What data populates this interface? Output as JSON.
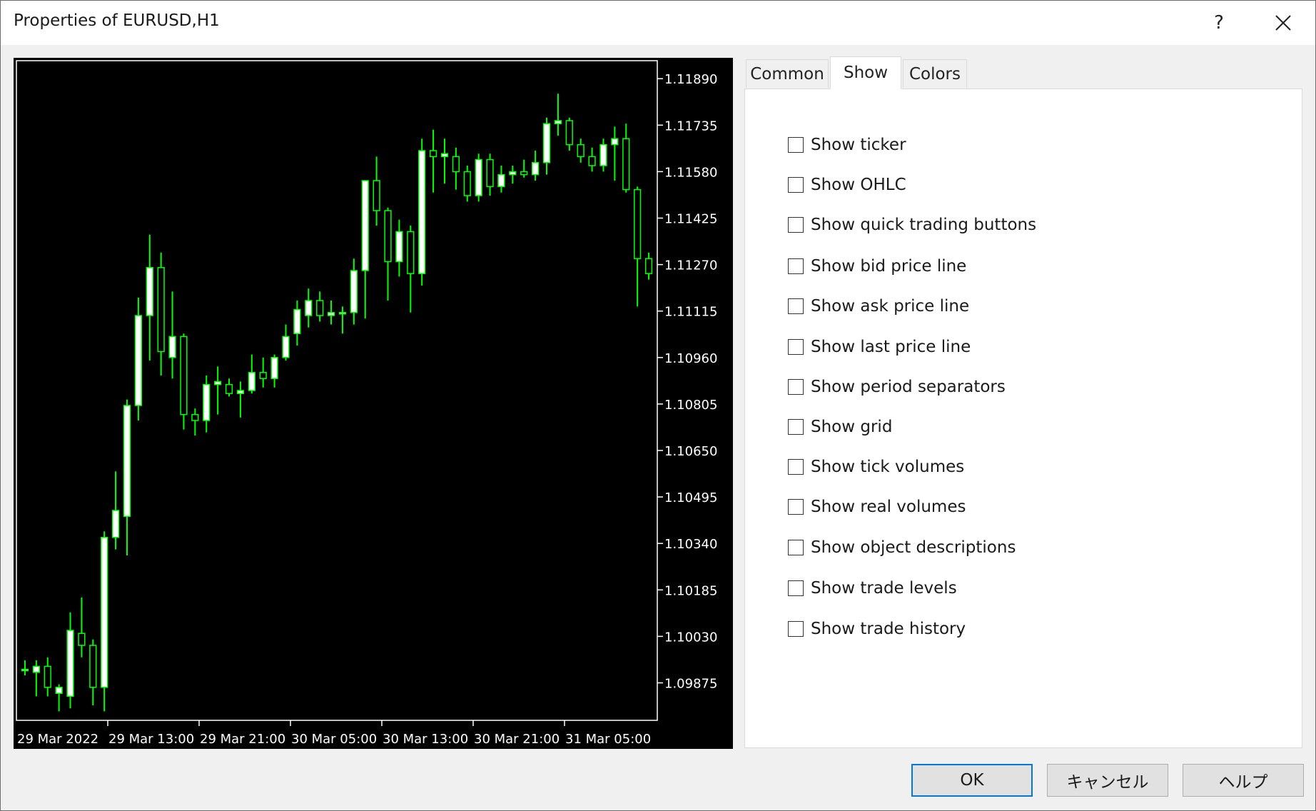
{
  "window": {
    "title": "Properties of EURUSD,H1",
    "help_glyph": "?",
    "close_glyph": "✕"
  },
  "chart": {
    "symbol": "EURUSD",
    "timeframe": "H1",
    "background": "#000000",
    "bull_color": "#ffffff",
    "wick_color": "#00ff00",
    "axis_color": "#ffffff"
  },
  "chart_data": {
    "type": "candlestick",
    "ylim": [
      1.0975,
      1.1195
    ],
    "y_ticks": [
      "1.11890",
      "1.11735",
      "1.11580",
      "1.11425",
      "1.11270",
      "1.11115",
      "1.10960",
      "1.10805",
      "1.10650",
      "1.10495",
      "1.10340",
      "1.10185",
      "1.10030",
      "1.09875"
    ],
    "x_ticks": [
      "29 Mar 2022",
      "29 Mar 13:00",
      "29 Mar 21:00",
      "30 Mar 05:00",
      "30 Mar 13:00",
      "30 Mar 21:00",
      "31 Mar 05:00"
    ],
    "candles": [
      {
        "o": 1.0992,
        "h": 1.0995,
        "l": 1.099,
        "c": 1.0992
      },
      {
        "o": 1.0991,
        "h": 1.0995,
        "l": 1.0983,
        "c": 1.0993
      },
      {
        "o": 1.0993,
        "h": 1.0996,
        "l": 1.0983,
        "c": 1.0986
      },
      {
        "o": 1.0984,
        "h": 1.0987,
        "l": 1.0978,
        "c": 1.0986
      },
      {
        "o": 1.0983,
        "h": 1.1011,
        "l": 1.0979,
        "c": 1.1005
      },
      {
        "o": 1.1004,
        "h": 1.1016,
        "l": 1.0996,
        "c": 1.1
      },
      {
        "o": 1.1,
        "h": 1.1002,
        "l": 1.098,
        "c": 1.0986
      },
      {
        "o": 1.0986,
        "h": 1.1038,
        "l": 1.0978,
        "c": 1.1036
      },
      {
        "o": 1.1036,
        "h": 1.1058,
        "l": 1.1032,
        "c": 1.1045
      },
      {
        "o": 1.1043,
        "h": 1.1082,
        "l": 1.103,
        "c": 1.108
      },
      {
        "o": 1.108,
        "h": 1.1116,
        "l": 1.1075,
        "c": 1.111
      },
      {
        "o": 1.111,
        "h": 1.1137,
        "l": 1.1095,
        "c": 1.1126
      },
      {
        "o": 1.1126,
        "h": 1.1131,
        "l": 1.109,
        "c": 1.1098
      },
      {
        "o": 1.1096,
        "h": 1.1118,
        "l": 1.1089,
        "c": 1.1103
      },
      {
        "o": 1.1103,
        "h": 1.1104,
        "l": 1.1072,
        "c": 1.1077
      },
      {
        "o": 1.1077,
        "h": 1.1079,
        "l": 1.107,
        "c": 1.1075
      },
      {
        "o": 1.1075,
        "h": 1.109,
        "l": 1.1071,
        "c": 1.1087
      },
      {
        "o": 1.1087,
        "h": 1.1093,
        "l": 1.1077,
        "c": 1.1088
      },
      {
        "o": 1.1087,
        "h": 1.1089,
        "l": 1.1083,
        "c": 1.1084
      },
      {
        "o": 1.1084,
        "h": 1.1088,
        "l": 1.1076,
        "c": 1.1085
      },
      {
        "o": 1.1085,
        "h": 1.1097,
        "l": 1.1084,
        "c": 1.1091
      },
      {
        "o": 1.1091,
        "h": 1.1096,
        "l": 1.1086,
        "c": 1.1089
      },
      {
        "o": 1.1089,
        "h": 1.1097,
        "l": 1.1086,
        "c": 1.1096
      },
      {
        "o": 1.1096,
        "h": 1.1107,
        "l": 1.1095,
        "c": 1.1103
      },
      {
        "o": 1.1104,
        "h": 1.1115,
        "l": 1.11,
        "c": 1.1112
      },
      {
        "o": 1.111,
        "h": 1.1119,
        "l": 1.1106,
        "c": 1.1115
      },
      {
        "o": 1.1115,
        "h": 1.1118,
        "l": 1.1108,
        "c": 1.111
      },
      {
        "o": 1.111,
        "h": 1.1115,
        "l": 1.1107,
        "c": 1.1111
      },
      {
        "o": 1.1111,
        "h": 1.1113,
        "l": 1.1104,
        "c": 1.1111
      },
      {
        "o": 1.1111,
        "h": 1.1129,
        "l": 1.1107,
        "c": 1.1125
      },
      {
        "o": 1.1125,
        "h": 1.1134,
        "l": 1.1109,
        "c": 1.1155
      },
      {
        "o": 1.1155,
        "h": 1.1163,
        "l": 1.114,
        "c": 1.1145
      },
      {
        "o": 1.1145,
        "h": 1.1146,
        "l": 1.1115,
        "c": 1.1128
      },
      {
        "o": 1.1128,
        "h": 1.1142,
        "l": 1.1123,
        "c": 1.1138
      },
      {
        "o": 1.1138,
        "h": 1.114,
        "l": 1.1111,
        "c": 1.1124
      },
      {
        "o": 1.1124,
        "h": 1.1169,
        "l": 1.112,
        "c": 1.1165
      },
      {
        "o": 1.1165,
        "h": 1.1172,
        "l": 1.1151,
        "c": 1.1163
      },
      {
        "o": 1.1163,
        "h": 1.1169,
        "l": 1.1154,
        "c": 1.1164
      },
      {
        "o": 1.1163,
        "h": 1.1166,
        "l": 1.1152,
        "c": 1.1158
      },
      {
        "o": 1.1158,
        "h": 1.116,
        "l": 1.1148,
        "c": 1.115
      },
      {
        "o": 1.115,
        "h": 1.1164,
        "l": 1.1148,
        "c": 1.1162
      },
      {
        "o": 1.1162,
        "h": 1.1164,
        "l": 1.115,
        "c": 1.1153
      },
      {
        "o": 1.1153,
        "h": 1.116,
        "l": 1.1151,
        "c": 1.1157
      },
      {
        "o": 1.1157,
        "h": 1.116,
        "l": 1.1154,
        "c": 1.1158
      },
      {
        "o": 1.1158,
        "h": 1.1162,
        "l": 1.1156,
        "c": 1.1157
      },
      {
        "o": 1.1157,
        "h": 1.1165,
        "l": 1.1155,
        "c": 1.1161
      },
      {
        "o": 1.1161,
        "h": 1.1176,
        "l": 1.1157,
        "c": 1.1174
      },
      {
        "o": 1.1174,
        "h": 1.1184,
        "l": 1.117,
        "c": 1.1175
      },
      {
        "o": 1.1175,
        "h": 1.1176,
        "l": 1.1165,
        "c": 1.1167
      },
      {
        "o": 1.1167,
        "h": 1.1169,
        "l": 1.1161,
        "c": 1.1163
      },
      {
        "o": 1.1163,
        "h": 1.1166,
        "l": 1.1158,
        "c": 1.116
      },
      {
        "o": 1.116,
        "h": 1.1169,
        "l": 1.1158,
        "c": 1.1167
      },
      {
        "o": 1.1167,
        "h": 1.1173,
        "l": 1.1155,
        "c": 1.1169
      },
      {
        "o": 1.1169,
        "h": 1.1174,
        "l": 1.1151,
        "c": 1.1152
      },
      {
        "o": 1.1152,
        "h": 1.1153,
        "l": 1.1113,
        "c": 1.1129
      },
      {
        "o": 1.1129,
        "h": 1.1131,
        "l": 1.1122,
        "c": 1.1124
      }
    ]
  },
  "tabs": [
    {
      "label": "Common",
      "active": false
    },
    {
      "label": "Show",
      "active": true
    },
    {
      "label": "Colors",
      "active": false
    }
  ],
  "options": [
    {
      "label": "Show ticker",
      "checked": false
    },
    {
      "label": "Show OHLC",
      "checked": false
    },
    {
      "label": "Show quick trading buttons",
      "checked": false
    },
    {
      "label": "Show bid price line",
      "checked": false
    },
    {
      "label": "Show ask price line",
      "checked": false
    },
    {
      "label": "Show last price line",
      "checked": false
    },
    {
      "label": "Show period separators",
      "checked": false
    },
    {
      "label": "Show grid",
      "checked": false
    },
    {
      "label": "Show tick volumes",
      "checked": false
    },
    {
      "label": "Show real volumes",
      "checked": false
    },
    {
      "label": "Show object descriptions",
      "checked": false
    },
    {
      "label": "Show trade levels",
      "checked": false
    },
    {
      "label": "Show trade history",
      "checked": false
    }
  ],
  "buttons": {
    "ok": "OK",
    "cancel": "キャンセル",
    "help": "ヘルプ"
  },
  "colors": {
    "accent": "#0078d7",
    "dialog_bg": "#f0f0f0"
  }
}
